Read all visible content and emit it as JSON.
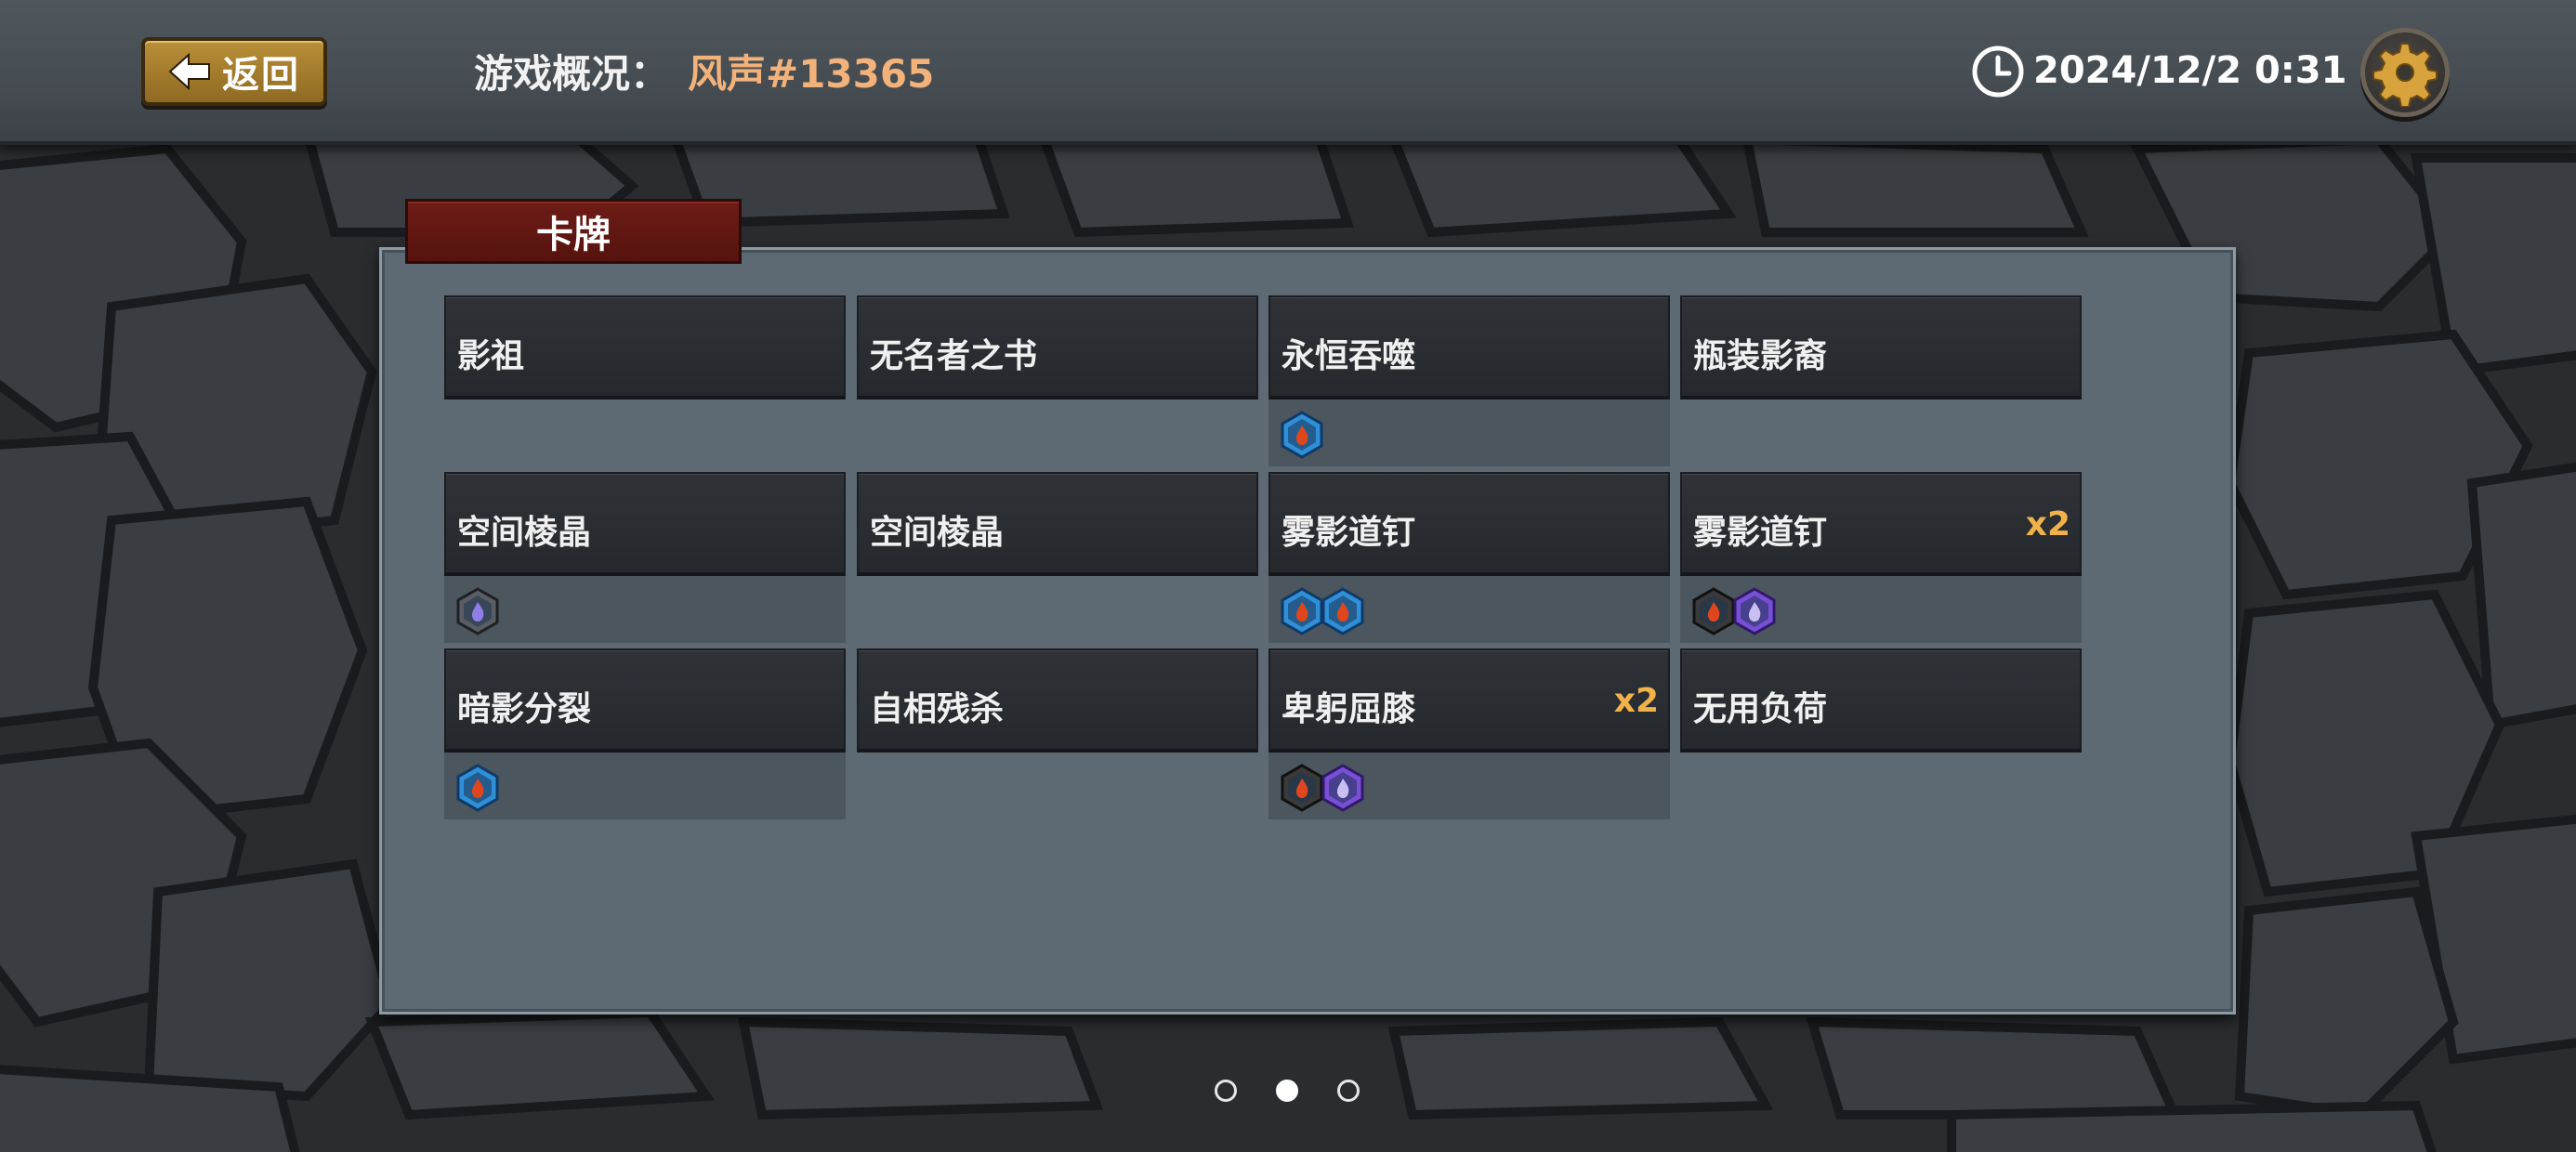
{
  "header": {
    "back_label": "返回",
    "title_label": "游戏概况：",
    "title_value": "风声#13365",
    "datetime": "2024/12/2 0:31"
  },
  "panel": {
    "tab_label": "卡牌"
  },
  "cards": [
    {
      "name": "影祖",
      "count": "",
      "tokens": []
    },
    {
      "name": "无名者之书",
      "count": "",
      "tokens": []
    },
    {
      "name": "永恒吞噬",
      "count": "",
      "tokens": [
        "blue-hex-icon"
      ]
    },
    {
      "name": "瓶装影裔",
      "count": "",
      "tokens": []
    },
    {
      "name": "空间棱晶",
      "count": "",
      "tokens": [
        "gray-hex-icon"
      ]
    },
    {
      "name": "空间棱晶",
      "count": "",
      "tokens": []
    },
    {
      "name": "雾影道钉",
      "count": "",
      "tokens": [
        "blue-hex-icon",
        "blue-hex-icon"
      ]
    },
    {
      "name": "雾影道钉",
      "count": "x2",
      "tokens": [
        "dark-hex-icon",
        "purple-hex-icon"
      ]
    },
    {
      "name": "暗影分裂",
      "count": "",
      "tokens": [
        "blue-hex-icon"
      ]
    },
    {
      "name": "自相残杀",
      "count": "",
      "tokens": []
    },
    {
      "name": "卑躬屈膝",
      "count": "x2",
      "tokens": [
        "dark-hex-icon",
        "purple-hex-icon"
      ]
    },
    {
      "name": "无用负荷",
      "count": "",
      "tokens": []
    }
  ],
  "pager": {
    "pages": 3,
    "active": 2
  },
  "colors": {
    "accent_title": "#f2b27a",
    "count": "#f2b24a",
    "tab_red": "#6e1c16",
    "token_blue": "#2f8fd8",
    "token_purple": "#7a4fd8",
    "token_dark": "#3a3a3a"
  }
}
